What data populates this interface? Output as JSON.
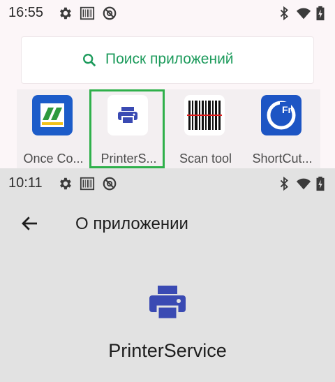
{
  "top_screen": {
    "status_bar": {
      "time": "16:55"
    },
    "search": {
      "placeholder": "Поиск приложений"
    },
    "apps": [
      {
        "label": "Once Co..."
      },
      {
        "label": "PrinterS..."
      },
      {
        "label": "Scan tool"
      },
      {
        "label": "ShortCut..."
      }
    ]
  },
  "bottom_screen": {
    "status_bar": {
      "time": "10:11"
    },
    "app_bar": {
      "title": "О приложении"
    },
    "app_name": "PrinterService"
  },
  "colors": {
    "accent_green": "#1d9b5c",
    "highlight_green": "#2fb04b",
    "printer_blue": "#3a4ab3"
  }
}
